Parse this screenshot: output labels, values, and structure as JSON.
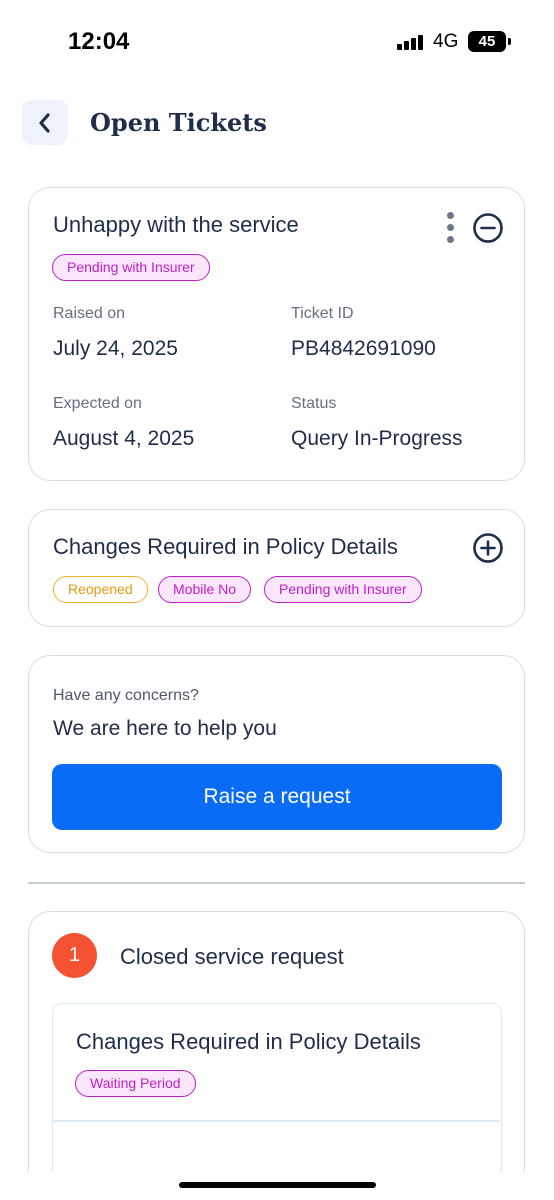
{
  "status_bar": {
    "time": "12:04",
    "network": "4G",
    "battery": "45"
  },
  "header": {
    "title": "Open Tickets",
    "back_icon": "chevron-left-icon"
  },
  "open_tickets": [
    {
      "title": "Unhappy with the service",
      "expanded": true,
      "tags": [
        "Pending with Insurer"
      ],
      "fields": {
        "raised_on_label": "Raised on",
        "raised_on": "July 24, 2025",
        "ticket_id_label": "Ticket ID",
        "ticket_id": "PB4842691090",
        "expected_on_label": "Expected on",
        "expected_on": "August 4, 2025",
        "status_label": "Status",
        "status": "Query In-Progress"
      }
    },
    {
      "title": "Changes Required in Policy Details",
      "expanded": false,
      "tags": [
        "Reopened",
        "Mobile No",
        "Pending with Insurer"
      ]
    }
  ],
  "help": {
    "label": "Have any concerns?",
    "title": "We are here to help you",
    "button": "Raise a request"
  },
  "closed": {
    "count": "1",
    "title": "Closed service request",
    "items": [
      {
        "title": "Changes Required in Policy Details",
        "tag": "Waiting Period"
      }
    ]
  },
  "colors": {
    "primary": "#0a6cf5",
    "text": "#1f2d4a",
    "chip_pink": "#c020c9",
    "chip_orange": "#f4b02e",
    "badge": "#f45232"
  }
}
